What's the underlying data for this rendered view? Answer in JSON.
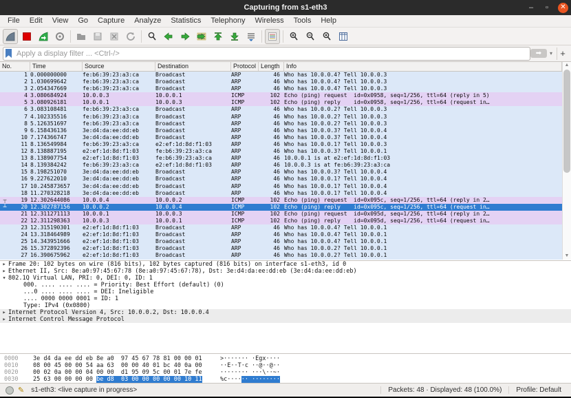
{
  "window": {
    "title": "Capturing from s1-eth3",
    "minimize_glyph": "–",
    "maximize_glyph": "▫",
    "close_glyph": "✕"
  },
  "menu": {
    "items": [
      "File",
      "Edit",
      "View",
      "Go",
      "Capture",
      "Analyze",
      "Statistics",
      "Telephony",
      "Wireless",
      "Tools",
      "Help"
    ]
  },
  "toolbar": {
    "icons": [
      {
        "name": "start-capture-icon",
        "type": "fin-blue",
        "active": true
      },
      {
        "name": "stop-capture-icon",
        "type": "stop"
      },
      {
        "name": "restart-capture-icon",
        "type": "fin-green"
      },
      {
        "name": "capture-options-icon",
        "type": "gear"
      },
      {
        "name": "sep1",
        "type": "sep"
      },
      {
        "name": "open-file-icon",
        "type": "folder"
      },
      {
        "name": "save-file-icon",
        "type": "save"
      },
      {
        "name": "close-file-icon",
        "type": "close-x"
      },
      {
        "name": "reload-icon",
        "type": "reload"
      },
      {
        "name": "sep2",
        "type": "sep"
      },
      {
        "name": "find-packet-icon",
        "type": "find"
      },
      {
        "name": "previous-packet-icon",
        "type": "arrow-left"
      },
      {
        "name": "next-packet-icon",
        "type": "arrow-right"
      },
      {
        "name": "go-to-packet-icon",
        "type": "goto"
      },
      {
        "name": "first-packet-icon",
        "type": "arrow-top"
      },
      {
        "name": "last-packet-icon",
        "type": "arrow-bottom"
      },
      {
        "name": "auto-scroll-icon",
        "type": "autoscroll"
      },
      {
        "name": "sep3",
        "type": "sep"
      },
      {
        "name": "colorize-icon",
        "type": "colorize",
        "active": true
      },
      {
        "name": "sep4",
        "type": "sep"
      },
      {
        "name": "zoom-in-icon",
        "type": "zoom-in"
      },
      {
        "name": "zoom-out-icon",
        "type": "zoom-out"
      },
      {
        "name": "zoom-reset-icon",
        "type": "zoom-reset"
      },
      {
        "name": "resize-columns-icon",
        "type": "columns"
      }
    ]
  },
  "filter": {
    "placeholder": "Apply a display filter ... <Ctrl-/>",
    "apply_glyph": "➡",
    "caret_glyph": "▾",
    "add_glyph": "+"
  },
  "packet_list": {
    "columns": [
      "No.",
      "Time",
      "Source",
      "Destination",
      "Protocol",
      "Length",
      "Info"
    ],
    "rows": [
      {
        "no": "1",
        "time": "0.000000000",
        "src": "fe:b6:39:23:a3:ca",
        "dst": "Broadcast",
        "proto": "ARP",
        "len": "46",
        "info": "Who has 10.0.0.4? Tell 10.0.0.3",
        "type": "arp"
      },
      {
        "no": "2",
        "time": "1.030699642",
        "src": "fe:b6:39:23:a3:ca",
        "dst": "Broadcast",
        "proto": "ARP",
        "len": "46",
        "info": "Who has 10.0.0.4? Tell 10.0.0.3",
        "type": "arp"
      },
      {
        "no": "3",
        "time": "2.054347669",
        "src": "fe:b6:39:23:a3:ca",
        "dst": "Broadcast",
        "proto": "ARP",
        "len": "46",
        "info": "Who has 10.0.0.4? Tell 10.0.0.3",
        "type": "arp"
      },
      {
        "no": "4",
        "time": "3.080684924",
        "src": "10.0.0.3",
        "dst": "10.0.0.1",
        "proto": "ICMP",
        "len": "102",
        "info": "Echo (ping) request  id=0x0958, seq=1/256, ttl=64 (reply in 5)",
        "type": "icmp"
      },
      {
        "no": "5",
        "time": "3.080926181",
        "src": "10.0.0.1",
        "dst": "10.0.0.3",
        "proto": "ICMP",
        "len": "102",
        "info": "Echo (ping) reply    id=0x0958, seq=1/256, ttl=64 (request in…",
        "type": "icmp"
      },
      {
        "no": "6",
        "time": "3.083108481",
        "src": "fe:b6:39:23:a3:ca",
        "dst": "Broadcast",
        "proto": "ARP",
        "len": "46",
        "info": "Who has 10.0.0.2? Tell 10.0.0.3",
        "type": "arp"
      },
      {
        "no": "7",
        "time": "4.102335516",
        "src": "fe:b6:39:23:a3:ca",
        "dst": "Broadcast",
        "proto": "ARP",
        "len": "46",
        "info": "Who has 10.0.0.2? Tell 10.0.0.3",
        "type": "arp"
      },
      {
        "no": "8",
        "time": "5.126351697",
        "src": "fe:b6:39:23:a3:ca",
        "dst": "Broadcast",
        "proto": "ARP",
        "len": "46",
        "info": "Who has 10.0.0.2? Tell 10.0.0.3",
        "type": "arp"
      },
      {
        "no": "9",
        "time": "6.158436136",
        "src": "3e:d4:da:ee:dd:eb",
        "dst": "Broadcast",
        "proto": "ARP",
        "len": "46",
        "info": "Who has 10.0.0.3? Tell 10.0.0.4",
        "type": "arp"
      },
      {
        "no": "10",
        "time": "7.174366747",
        "src": "3e:d4:da:ee:dd:eb",
        "dst": "Broadcast",
        "proto": "ARP",
        "len": "46",
        "info": "Who has 10.0.0.3? Tell 10.0.0.4",
        "type": "arp"
      },
      {
        "no": "11",
        "time": "8.136549984",
        "src": "fe:b6:39:23:a3:ca",
        "dst": "e2:ef:1d:8d:f1:03",
        "proto": "ARP",
        "len": "46",
        "info": "Who has 10.0.0.1? Tell 10.0.0.3",
        "type": "arp"
      },
      {
        "no": "12",
        "time": "8.138887195",
        "src": "e2:ef:1d:8d:f1:03",
        "dst": "fe:b6:39:23:a3:ca",
        "proto": "ARP",
        "len": "46",
        "info": "Who has 10.0.0.3? Tell 10.0.0.1",
        "type": "arp"
      },
      {
        "no": "13",
        "time": "8.138907754",
        "src": "e2:ef:1d:8d:f1:03",
        "dst": "fe:b6:39:23:a3:ca",
        "proto": "ARP",
        "len": "46",
        "info": "10.0.0.1 is at e2:ef:1d:8d:f1:03",
        "type": "arp"
      },
      {
        "no": "14",
        "time": "8.139384242",
        "src": "fe:b6:39:23:a3:ca",
        "dst": "e2:ef:1d:8d:f1:03",
        "proto": "ARP",
        "len": "46",
        "info": "10.0.0.3 is at fe:b6:39:23:a3:ca",
        "type": "arp"
      },
      {
        "no": "15",
        "time": "8.198251070",
        "src": "3e:d4:da:ee:dd:eb",
        "dst": "Broadcast",
        "proto": "ARP",
        "len": "46",
        "info": "Who has 10.0.0.3? Tell 10.0.0.4",
        "type": "arp"
      },
      {
        "no": "16",
        "time": "9.227622010",
        "src": "3e:d4:da:ee:dd:eb",
        "dst": "Broadcast",
        "proto": "ARP",
        "len": "46",
        "info": "Who has 10.0.0.1? Tell 10.0.0.4",
        "type": "arp"
      },
      {
        "no": "17",
        "time": "10.245873657",
        "src": "3e:d4:da:ee:dd:eb",
        "dst": "Broadcast",
        "proto": "ARP",
        "len": "46",
        "info": "Who has 10.0.0.1? Tell 10.0.0.4",
        "type": "arp"
      },
      {
        "no": "18",
        "time": "11.270328218",
        "src": "3e:d4:da:ee:dd:eb",
        "dst": "Broadcast",
        "proto": "ARP",
        "len": "46",
        "info": "Who has 10.0.0.1? Tell 10.0.0.4",
        "type": "arp"
      },
      {
        "no": "19",
        "time": "12.302644086",
        "src": "10.0.0.4",
        "dst": "10.0.0.2",
        "proto": "ICMP",
        "len": "102",
        "info": "Echo (ping) request  id=0x095c, seq=1/256, ttl=64 (reply in 2…",
        "type": "icmp",
        "marker": "┬"
      },
      {
        "no": "20",
        "time": "12.302787156",
        "src": "10.0.0.2",
        "dst": "10.0.0.4",
        "proto": "ICMP",
        "len": "102",
        "info": "Echo (ping) reply    id=0x095c, seq=1/256, ttl=64 (request in…",
        "type": "icmp",
        "selected": true,
        "marker": "┴"
      },
      {
        "no": "21",
        "time": "12.311271113",
        "src": "10.0.0.1",
        "dst": "10.0.0.3",
        "proto": "ICMP",
        "len": "102",
        "info": "Echo (ping) request  id=0x095d, seq=1/256, ttl=64 (reply in 2…",
        "type": "icmp"
      },
      {
        "no": "22",
        "time": "12.311298363",
        "src": "10.0.0.3",
        "dst": "10.0.0.1",
        "proto": "ICMP",
        "len": "102",
        "info": "Echo (ping) reply    id=0x095d, seq=1/256, ttl=64 (request in…",
        "type": "icmp"
      },
      {
        "no": "23",
        "time": "12.315190301",
        "src": "e2:ef:1d:8d:f1:03",
        "dst": "Broadcast",
        "proto": "ARP",
        "len": "46",
        "info": "Who has 10.0.0.4? Tell 10.0.0.1",
        "type": "arp"
      },
      {
        "no": "24",
        "time": "13.318464989",
        "src": "e2:ef:1d:8d:f1:03",
        "dst": "Broadcast",
        "proto": "ARP",
        "len": "46",
        "info": "Who has 10.0.0.4? Tell 10.0.0.1",
        "type": "arp"
      },
      {
        "no": "25",
        "time": "14.343951666",
        "src": "e2:ef:1d:8d:f1:03",
        "dst": "Broadcast",
        "proto": "ARP",
        "len": "46",
        "info": "Who has 10.0.0.4? Tell 10.0.0.1",
        "type": "arp"
      },
      {
        "no": "26",
        "time": "15.372892396",
        "src": "e2:ef:1d:8d:f1:03",
        "dst": "Broadcast",
        "proto": "ARP",
        "len": "46",
        "info": "Who has 10.0.0.2? Tell 10.0.0.1",
        "type": "arp"
      },
      {
        "no": "27",
        "time": "16.390675962",
        "src": "e2:ef:1d:8d:f1:03",
        "dst": "Broadcast",
        "proto": "ARP",
        "len": "46",
        "info": "Who has 10.0.0.2? Tell 10.0.0.1",
        "type": "arp"
      }
    ]
  },
  "details": {
    "rows": [
      {
        "glyph": "▸",
        "indent": 0,
        "text": "Frame 20: 102 bytes on wire (816 bits), 102 bytes captured (816 bits) on interface s1-eth3, id 0"
      },
      {
        "glyph": "▸",
        "indent": 0,
        "text": "Ethernet II, Src: 8e:a0:97:45:67:78 (8e:a0:97:45:67:78), Dst: 3e:d4:da:ee:dd:eb (3e:d4:da:ee:dd:eb)"
      },
      {
        "glyph": "▾",
        "indent": 0,
        "text": "802.1Q Virtual LAN, PRI: 0, DEI: 0, ID: 1"
      },
      {
        "glyph": "",
        "indent": 1,
        "text": "000. .... .... .... = Priority: Best Effort (default) (0)"
      },
      {
        "glyph": "",
        "indent": 1,
        "text": "...0 .... .... .... = DEI: Ineligible"
      },
      {
        "glyph": "",
        "indent": 1,
        "text": ".... 0000 0000 0001 = ID: 1"
      },
      {
        "glyph": "",
        "indent": 1,
        "text": "Type: IPv4 (0x0800)"
      },
      {
        "glyph": "▸",
        "indent": 0,
        "text": "Internet Protocol Version 4, Src: 10.0.0.2, Dst: 10.0.0.4",
        "shaded": true
      },
      {
        "glyph": "▸",
        "indent": 0,
        "text": "Internet Control Message Protocol",
        "shaded": true
      }
    ]
  },
  "hex": {
    "rows": [
      {
        "offset": "0000",
        "hex": [
          {
            "t": "3e d4 da ee dd eb 8e a0  97 45 67 78 81 00 00 01"
          }
        ],
        "ascii": [
          {
            "t": ">······· ·Egx····"
          }
        ]
      },
      {
        "offset": "0010",
        "hex": [
          {
            "t": "08 00 45 00 00 54 aa 63  00 00 40 01 bc 40 0a 00"
          }
        ],
        "ascii": [
          {
            "t": "··E··T·c ··@··@··"
          }
        ]
      },
      {
        "offset": "0020",
        "hex": [
          {
            "t": "00 02 0a 00 00 04 00 00  d1 95 09 5c 00 01 7e fe"
          }
        ],
        "ascii": [
          {
            "t": "········ ···\\··~·"
          }
        ]
      },
      {
        "offset": "0030",
        "hex": [
          {
            "t": "25 63 00 00 00 00 "
          },
          {
            "t": "be d8  03 00 00 00 00 00 10 11",
            "sel": true
          }
        ],
        "ascii": [
          {
            "t": "%c····"
          },
          {
            "t": "·· ········",
            "sel": true
          }
        ]
      }
    ]
  },
  "statusbar": {
    "capture_status": "s1-eth3: <live capture in progress>",
    "packet_counts": "Packets: 48 · Displayed: 48 (100.0%)",
    "profile": "Profile: Default",
    "pencil_glyph": "✎"
  },
  "scrollbar": {
    "up_glyph": "▲",
    "down_glyph": "▼"
  },
  "colors": {
    "arp_row": "#dce8f8",
    "icmp_row": "#e4d2f4",
    "selected_row": "#2f7cd0",
    "titlebar": "#2b2b2b",
    "close_button": "#e95420",
    "hex_selection": "#2f7cd0"
  }
}
